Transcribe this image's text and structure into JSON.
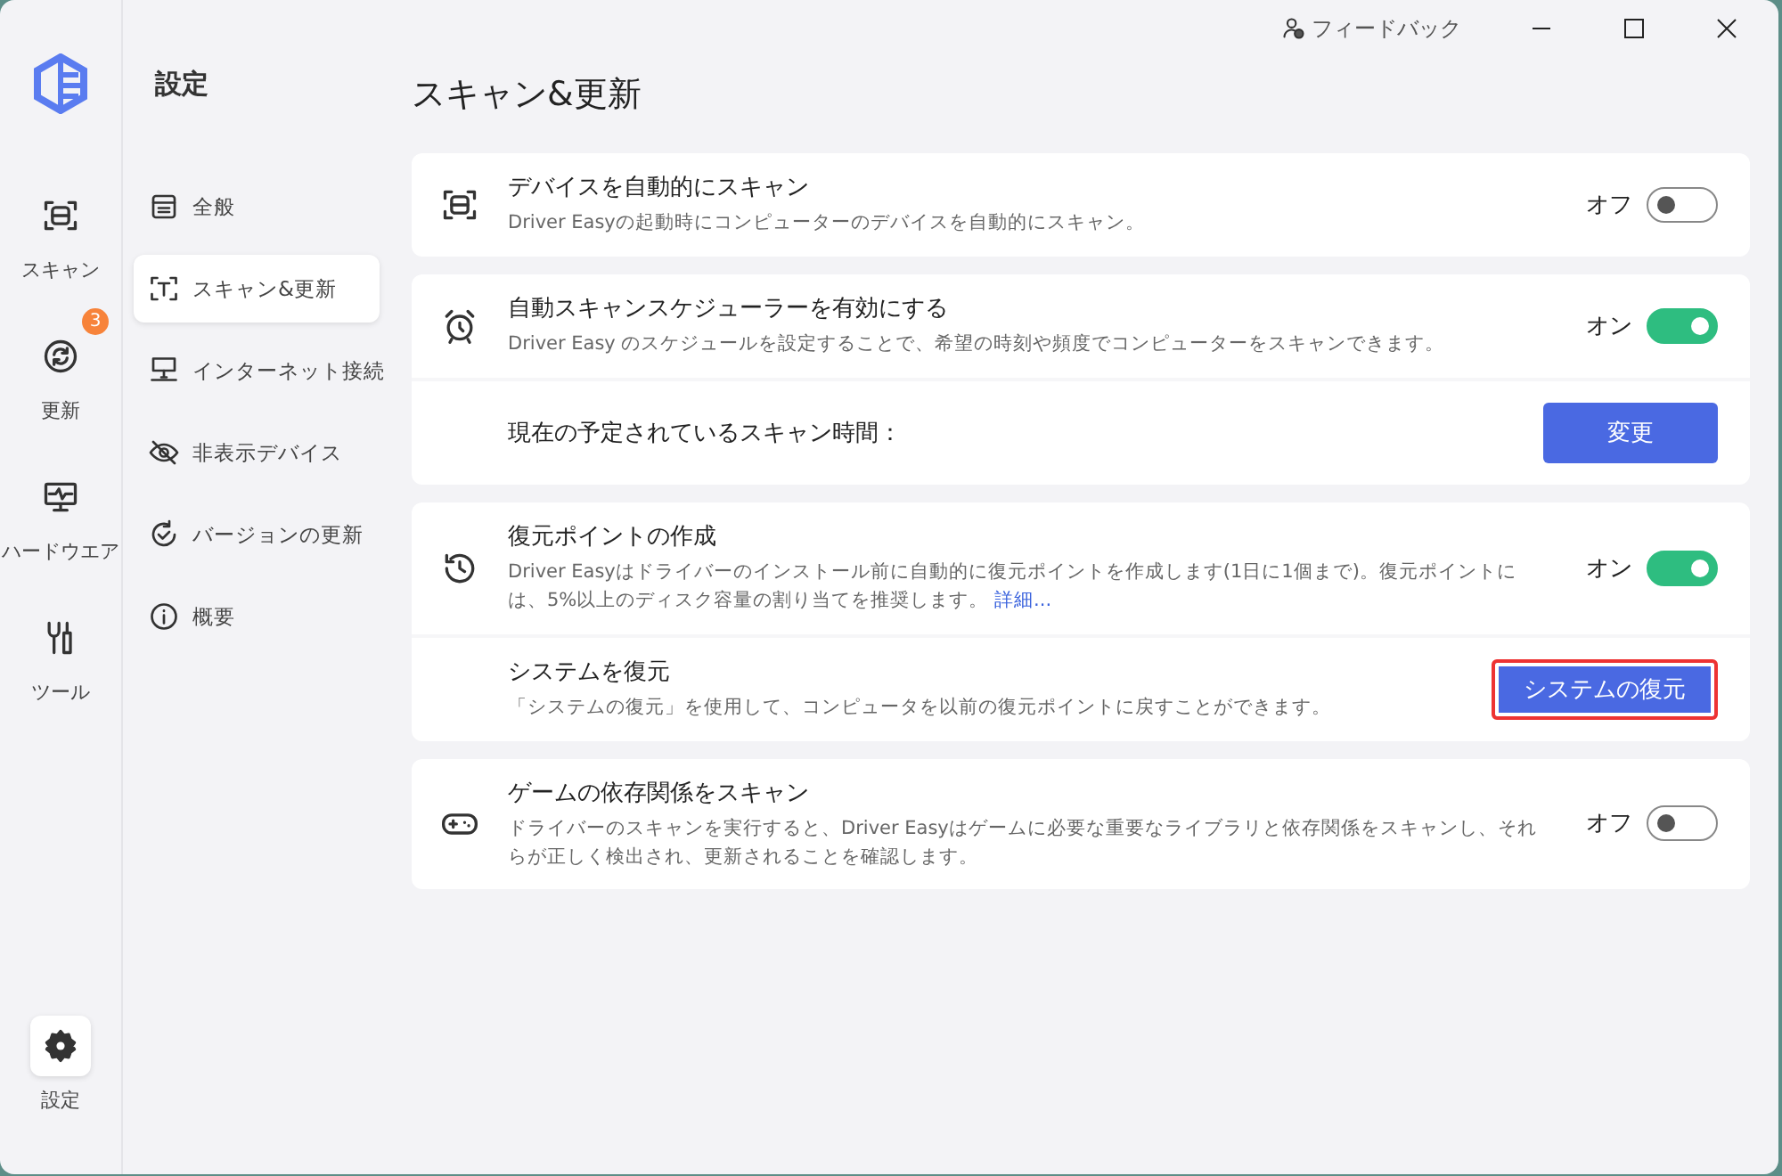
{
  "titlebar": {
    "feedback": "フィードバック"
  },
  "rail": [
    {
      "label": "スキャン",
      "selected": false
    },
    {
      "label": "更新",
      "selected": false,
      "badge": "3"
    },
    {
      "label": "ハードウエア",
      "selected": false
    },
    {
      "label": "ツール",
      "selected": false
    }
  ],
  "rail_bottom": {
    "label": "設定",
    "selected": true
  },
  "menu": {
    "title": "設定",
    "items": [
      {
        "label": "全般",
        "selected": false
      },
      {
        "label": "スキャン&更新",
        "selected": true
      },
      {
        "label": "インターネット接続",
        "selected": false
      },
      {
        "label": "非表示デバイス",
        "selected": false
      },
      {
        "label": "バージョンの更新",
        "selected": false
      },
      {
        "label": "概要",
        "selected": false
      }
    ]
  },
  "page_title": "スキャン&更新",
  "sections": [
    {
      "rows": [
        {
          "kind": "toggle",
          "title": "デバイスを自動的にスキャン",
          "description": "Driver Easyの起動時にコンピューターのデバイスを自動的にスキャン。",
          "state_label": "オフ",
          "on": false
        }
      ]
    },
    {
      "rows": [
        {
          "kind": "toggle",
          "title": "自動スキャンスケジューラーを有効にする",
          "description": "Driver Easy のスケジュールを設定することで、希望の時刻や頻度でコンピューターをスキャンできます。",
          "state_label": "オン",
          "on": true
        },
        {
          "kind": "button",
          "title": "現在の予定されているスキャン時間：",
          "button": "変更",
          "highlighted": false
        }
      ]
    },
    {
      "rows": [
        {
          "kind": "toggle",
          "title": "復元ポイントの作成",
          "description": "Driver Easyはドライバーのインストール前に自動的に復元ポイントを作成します(1日に1個まで)。復元ポイントには、5%以上のディスク容量の割り当てを推奨します。",
          "link": "詳細...",
          "state_label": "オン",
          "on": true
        },
        {
          "kind": "button",
          "title": "システムを復元",
          "description": "「システムの復元」を使用して、コンピュータを以前の復元ポイントに戻すことができます。",
          "button": "システムの復元",
          "highlighted": true
        }
      ]
    },
    {
      "rows": [
        {
          "kind": "toggle",
          "title": "ゲームの依存関係をスキャン",
          "description": "ドライバーのスキャンを実行すると、Driver Easyはゲームに必要な重要なライブラリと依存関係をスキャンし、それらが正しく検出され、更新されることを確認します。",
          "state_label": "オフ",
          "on": false
        }
      ]
    }
  ]
}
